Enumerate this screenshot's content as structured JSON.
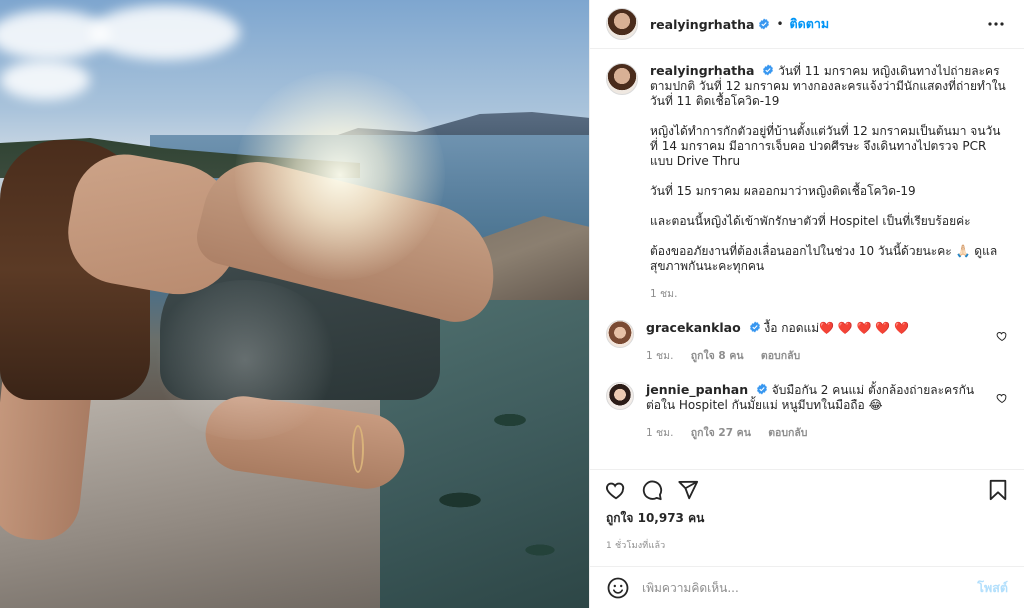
{
  "header": {
    "username": "realyingrhatha",
    "separator": "•",
    "follow_label": "ติดตาม",
    "more_icon": "more-horizontal-icon"
  },
  "caption": {
    "username": "realyingrhatha",
    "paragraphs": [
      "วันที่ 11 มกราคม หญิงเดินทางไปถ่ายละครตามปกติ วันที่ 12 มกราคม ทางกองละครแจ้งว่ามีนักแสดงที่ถ่ายทำในวันที่ 11 ติดเชื้อโควิด-19",
      "หญิงได้ทำการกักตัวอยู่ที่บ้านตั้งแต่วันที่ 12 มกราคมเป็นต้นมา จนวันที่ 14 มกราคม มีอาการเจ็บคอ ปวดศีรษะ จึงเดินทางไปตรวจ PCR แบบ Drive Thru",
      "วันที่ 15 มกราคม ผลออกมาว่าหญิงติดเชื้อโควิด-19",
      "และตอนนี้หญิงได้เข้าพักรักษาตัวที่ Hospitel เป็นที่เรียบร้อยค่ะ",
      "ต้องขออภัยงานที่ต้องเลื่อนออกไปในช่วง 10 วันนี้ด้วยนะคะ 🙏🏻 ดูแลสุขภาพกันนะคะทุกคน"
    ],
    "time": "1 ชม."
  },
  "comments": [
    {
      "username": "gracekanklao",
      "text": "งื้อ กอดแม่❤️ ❤️ ❤️ ❤️ ❤️",
      "time": "1 ชม.",
      "likes": "ถูกใจ 8 คน",
      "reply": "ตอบกลับ"
    },
    {
      "username": "jennie_panhan",
      "text": "จับมือกัน 2 คนแม่ ตั้งกล้องถ่ายละครกันต่อใน Hospitel กันมั้ยแม่ หนูมีบทในมือถือ 😂",
      "time": "1 ชม.",
      "likes": "ถูกใจ 27 คน",
      "reply": "ตอบกลับ"
    }
  ],
  "actions": {
    "like_icon": "heart-icon",
    "comment_icon": "comment-icon",
    "share_icon": "share-icon",
    "save_icon": "bookmark-icon"
  },
  "likes_text": "ถูกใจ 10,973 คน",
  "posted_ago": "1 ชั่วโมงที่แล้ว",
  "add_comment": {
    "placeholder": "เพิ่มความคิดเห็น...",
    "post_label": "โพสต์"
  },
  "colors": {
    "accent": "#0095f6",
    "post_disabled": "#b2dffc",
    "verified": "#3897f0"
  }
}
